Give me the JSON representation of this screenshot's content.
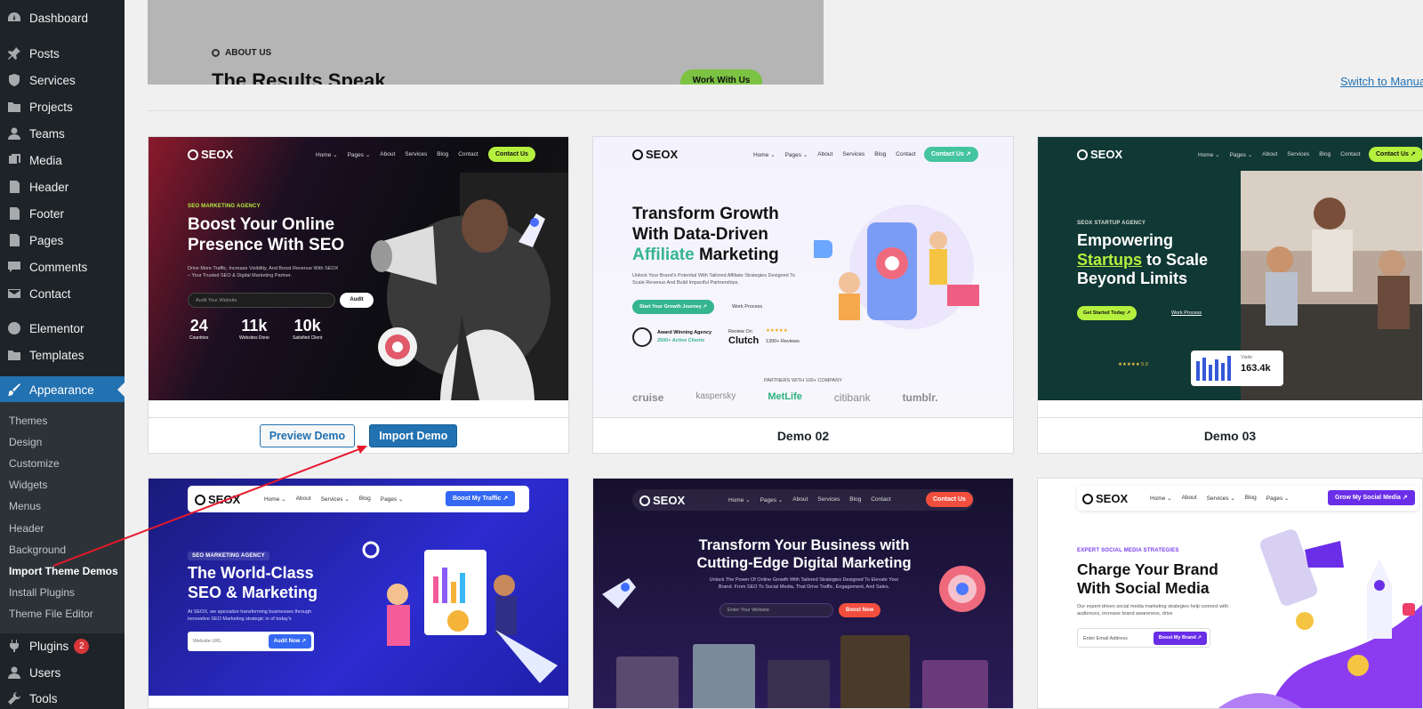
{
  "sidebar": {
    "items": [
      {
        "label": "Dashboard",
        "icon": "dashboard-icon"
      },
      {
        "label": "Posts",
        "icon": "pin-icon"
      },
      {
        "label": "Services",
        "icon": "shield-icon"
      },
      {
        "label": "Projects",
        "icon": "folder-icon"
      },
      {
        "label": "Teams",
        "icon": "user-icon"
      },
      {
        "label": "Media",
        "icon": "media-icon"
      },
      {
        "label": "Header",
        "icon": "page-icon"
      },
      {
        "label": "Footer",
        "icon": "page-icon"
      },
      {
        "label": "Pages",
        "icon": "page-icon"
      },
      {
        "label": "Comments",
        "icon": "comment-icon"
      },
      {
        "label": "Contact",
        "icon": "mail-icon"
      },
      {
        "label": "Elementor",
        "icon": "elementor-icon"
      },
      {
        "label": "Templates",
        "icon": "folder-icon"
      },
      {
        "label": "Appearance",
        "icon": "brush-icon"
      },
      {
        "label": "Plugins",
        "icon": "plug-icon",
        "badge": "2"
      },
      {
        "label": "Users",
        "icon": "user-icon"
      },
      {
        "label": "Tools",
        "icon": "wrench-icon"
      }
    ],
    "appearance_submenu": [
      "Themes",
      "Design",
      "Customize",
      "Widgets",
      "Menus",
      "Header",
      "Background",
      "Import Theme Demos",
      "Install Plugins",
      "Theme File Editor"
    ]
  },
  "top_preview": {
    "about_label": "ABOUT US",
    "heading": "The Results Speak",
    "button": "Work With Us"
  },
  "switch_link": "Switch to Manual",
  "demos": [
    {
      "preview_button": "Preview Demo",
      "import_button": "Import Demo",
      "site": {
        "logo": "SEOX",
        "nav": [
          "Home ⌄",
          "Pages ⌄",
          "About",
          "Services",
          "Blog",
          "Contact"
        ],
        "cta": "Contact Us",
        "tag": "SEO MARKETING AGENCY",
        "hero": "Boost Your Online Presence With SEO",
        "sub": "Drive More Traffic, Increase Visibility, And Boost Revenue With SEOX – Your Trusted SEO & Digital Marketing Partner.",
        "input_placeholder": "Audit Your Website",
        "input_button": "Audit",
        "stats": [
          {
            "n": "24",
            "l": "Countries"
          },
          {
            "n": "11k",
            "l": "Websites Done"
          },
          {
            "n": "10k",
            "l": "Satisfied Client"
          }
        ]
      }
    },
    {
      "title": "Demo 02",
      "site": {
        "logo": "SEOX",
        "nav": [
          "Home ⌄",
          "Pages ⌄",
          "About",
          "Services",
          "Blog",
          "Contact"
        ],
        "cta": "Contact Us ↗",
        "hero_line1": "Transform Growth",
        "hero_line2": "With Data-Driven",
        "hero_accent": "Affiliate",
        "hero_line3": " Marketing",
        "sub": "Unlock Your Brand's Potential With Tailored Affiliate Strategies Designed To Scale Revenue And Build Impactful Partnerships.",
        "btn1": "Start Your Growth Journey ↗",
        "btn2": "Work Process",
        "award": "Award Winning Agency",
        "award_sub": "2500+ Active Clients",
        "review_on": "Review On",
        "clutch": "Clutch",
        "reviews": "1300+ Reviews",
        "stars": "★★★★★",
        "partners": "PARTNERS WITH 100+ COMPANY",
        "logos": [
          "cruise",
          "kaspersky",
          "MetLife",
          "citibank",
          "tumblr."
        ]
      }
    },
    {
      "title": "Demo 03",
      "site": {
        "logo": "SEOX",
        "nav": [
          "Home ⌄",
          "Pages ⌄",
          "About",
          "Services",
          "Blog",
          "Contact"
        ],
        "cta": "Contact Us ↗",
        "tag": "SEOX STARTUP AGENCY",
        "hero_line1": "Empowering",
        "hero_accent": "Startups",
        "hero_line2": " to Scale",
        "hero_line3": "Beyond Limits",
        "btn1": "Get Started Today ↗",
        "btn2": "Work Process",
        "visits_label": "Visits",
        "visits": "163.4k",
        "rating": "★★★★★ 5.0"
      }
    },
    {
      "site": {
        "logo": "SEOX",
        "nav": [
          "Home ⌄",
          "About",
          "Services ⌄",
          "Blog",
          "Pages ⌄"
        ],
        "cta": "Boost My Traffic ↗",
        "tag": "SEO MARKETING AGENCY",
        "hero": "The World-Class SEO & Marketing",
        "sub": "At SEOX, we specialize transforming businesses through innovative SEO Marketing strategic in of today's",
        "input_placeholder": "Website URL",
        "input_button": "Audit Now ↗"
      }
    },
    {
      "site": {
        "logo": "SEOX",
        "nav": [
          "Home ⌄",
          "Pages ⌄",
          "About",
          "Services",
          "Blog",
          "Contact"
        ],
        "cta": "Contact Us",
        "hero": "Transform Your Business with Cutting-Edge Digital Marketing",
        "sub": "Unlock The Power Of Online Growth With Tailored Strategies Designed To Elevate Your Brand. From SEO To Social Media, That Drive Traffic, Engagement, And Sales.",
        "input_placeholder": "Enter Your Website",
        "input_button": "Boost Now"
      }
    },
    {
      "site": {
        "logo": "SEOX",
        "nav": [
          "Home ⌄",
          "About",
          "Services ⌄",
          "Blog",
          "Pages ⌄"
        ],
        "cta": "Grow My Social Media ↗",
        "tag": "EXPERT SOCIAL MEDIA STRATEGIES",
        "hero": "Charge Your Brand With Social Media",
        "sub": "Our expert-driven social media marketing strategies help connect with audiences, increase brand awareness, drive",
        "input_placeholder": "Enter Email Address",
        "input_button": "Boost My Brand ↗"
      }
    }
  ]
}
